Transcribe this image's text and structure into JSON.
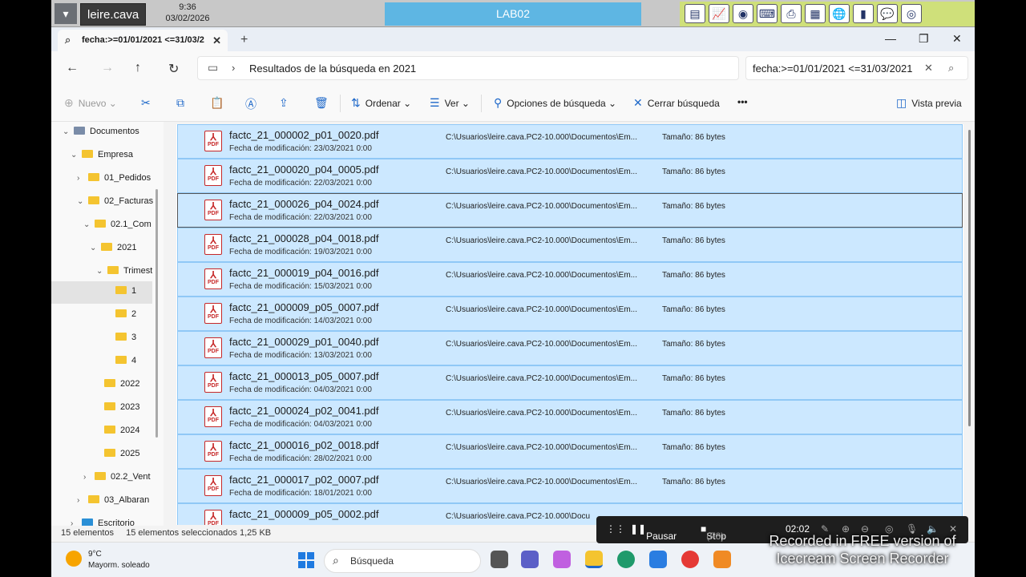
{
  "rdp_bar": {
    "user": "leire.cava",
    "time": "9:36",
    "date": "03/02/2026",
    "session": "LAB02"
  },
  "tab": {
    "title": "fecha:>=01/01/2021 <=31/03/2"
  },
  "address": {
    "breadcrumb": "Resultados de la búsqueda en 2021"
  },
  "search": {
    "value": "fecha:>=01/01/2021 <=31/03/2021"
  },
  "commands": {
    "new": "Nuevo",
    "sort": "Ordenar",
    "view": "Ver",
    "search_options": "Opciones de búsqueda",
    "close_search": "Cerrar búsqueda",
    "more": "•••",
    "preview": "Vista previa"
  },
  "sidebar": {
    "items": [
      {
        "label": "Documentos"
      },
      {
        "label": "Empresa"
      },
      {
        "label": "01_Pedidos"
      },
      {
        "label": "02_Facturas"
      },
      {
        "label": "02.1_Com"
      },
      {
        "label": "2021"
      },
      {
        "label": "Trimest"
      },
      {
        "label": "1"
      },
      {
        "label": "2"
      },
      {
        "label": "3"
      },
      {
        "label": "4"
      },
      {
        "label": "2022"
      },
      {
        "label": "2023"
      },
      {
        "label": "2024"
      },
      {
        "label": "2025"
      },
      {
        "label": "02.2_Vent"
      },
      {
        "label": "03_Albaran"
      },
      {
        "label": "Escritorio"
      }
    ]
  },
  "files": [
    {
      "name": "factc_21_000002_p01_0020.pdf",
      "date": "Fecha de modificación: 23/03/2021 0:00",
      "path": "C:\\Usuarios\\leire.cava.PC2-10.000\\Documentos\\Em...",
      "size": "Tamaño: 86 bytes"
    },
    {
      "name": "factc_21_000020_p04_0005.pdf",
      "date": "Fecha de modificación: 22/03/2021 0:00",
      "path": "C:\\Usuarios\\leire.cava.PC2-10.000\\Documentos\\Em...",
      "size": "Tamaño: 86 bytes"
    },
    {
      "name": "factc_21_000026_p04_0024.pdf",
      "date": "Fecha de modificación: 22/03/2021 0:00",
      "path": "C:\\Usuarios\\leire.cava.PC2-10.000\\Documentos\\Em...",
      "size": "Tamaño: 86 bytes"
    },
    {
      "name": "factc_21_000028_p04_0018.pdf",
      "date": "Fecha de modificación: 19/03/2021 0:00",
      "path": "C:\\Usuarios\\leire.cava.PC2-10.000\\Documentos\\Em...",
      "size": "Tamaño: 86 bytes"
    },
    {
      "name": "factc_21_000019_p04_0016.pdf",
      "date": "Fecha de modificación: 15/03/2021 0:00",
      "path": "C:\\Usuarios\\leire.cava.PC2-10.000\\Documentos\\Em...",
      "size": "Tamaño: 86 bytes"
    },
    {
      "name": "factc_21_000009_p05_0007.pdf",
      "date": "Fecha de modificación: 14/03/2021 0:00",
      "path": "C:\\Usuarios\\leire.cava.PC2-10.000\\Documentos\\Em...",
      "size": "Tamaño: 86 bytes"
    },
    {
      "name": "factc_21_000029_p01_0040.pdf",
      "date": "Fecha de modificación: 13/03/2021 0:00",
      "path": "C:\\Usuarios\\leire.cava.PC2-10.000\\Documentos\\Em...",
      "size": "Tamaño: 86 bytes"
    },
    {
      "name": "factc_21_000013_p05_0007.pdf",
      "date": "Fecha de modificación: 04/03/2021 0:00",
      "path": "C:\\Usuarios\\leire.cava.PC2-10.000\\Documentos\\Em...",
      "size": "Tamaño: 86 bytes"
    },
    {
      "name": "factc_21_000024_p02_0041.pdf",
      "date": "Fecha de modificación: 04/03/2021 0:00",
      "path": "C:\\Usuarios\\leire.cava.PC2-10.000\\Documentos\\Em...",
      "size": "Tamaño: 86 bytes"
    },
    {
      "name": "factc_21_000016_p02_0018.pdf",
      "date": "Fecha de modificación: 28/02/2021 0:00",
      "path": "C:\\Usuarios\\leire.cava.PC2-10.000\\Documentos\\Em...",
      "size": "Tamaño: 86 bytes"
    },
    {
      "name": "factc_21_000017_p02_0007.pdf",
      "date": "Fecha de modificación: 18/01/2021 0:00",
      "path": "C:\\Usuarios\\leire.cava.PC2-10.000\\Documentos\\Em...",
      "size": "Tamaño: 86 bytes"
    },
    {
      "name": "factc_21_000009_p05_0002.pdf",
      "date": "",
      "path": "C:\\Usuarios\\leire.cava.PC2-10.000\\Docu",
      "size": ""
    }
  ],
  "status": {
    "count": "15 elementos",
    "selected": "15 elementos seleccionados 1,25 KB"
  },
  "taskbar": {
    "temp": "9°C",
    "weather": "Mayorm. soleado",
    "search": "Búsqueda"
  },
  "recorder": {
    "pause": "Pausar",
    "stop": "Stop",
    "stop_key": "(F8)",
    "timer": "02:02",
    "watermark_1": "Recorded in FREE version of",
    "watermark_2": "Icecream Screen Recorder"
  },
  "colors": {
    "selection": "#cce8ff",
    "selection_border": "#90c8f6",
    "accent": "#1e68c9",
    "session_tab": "#5eb6e3"
  }
}
